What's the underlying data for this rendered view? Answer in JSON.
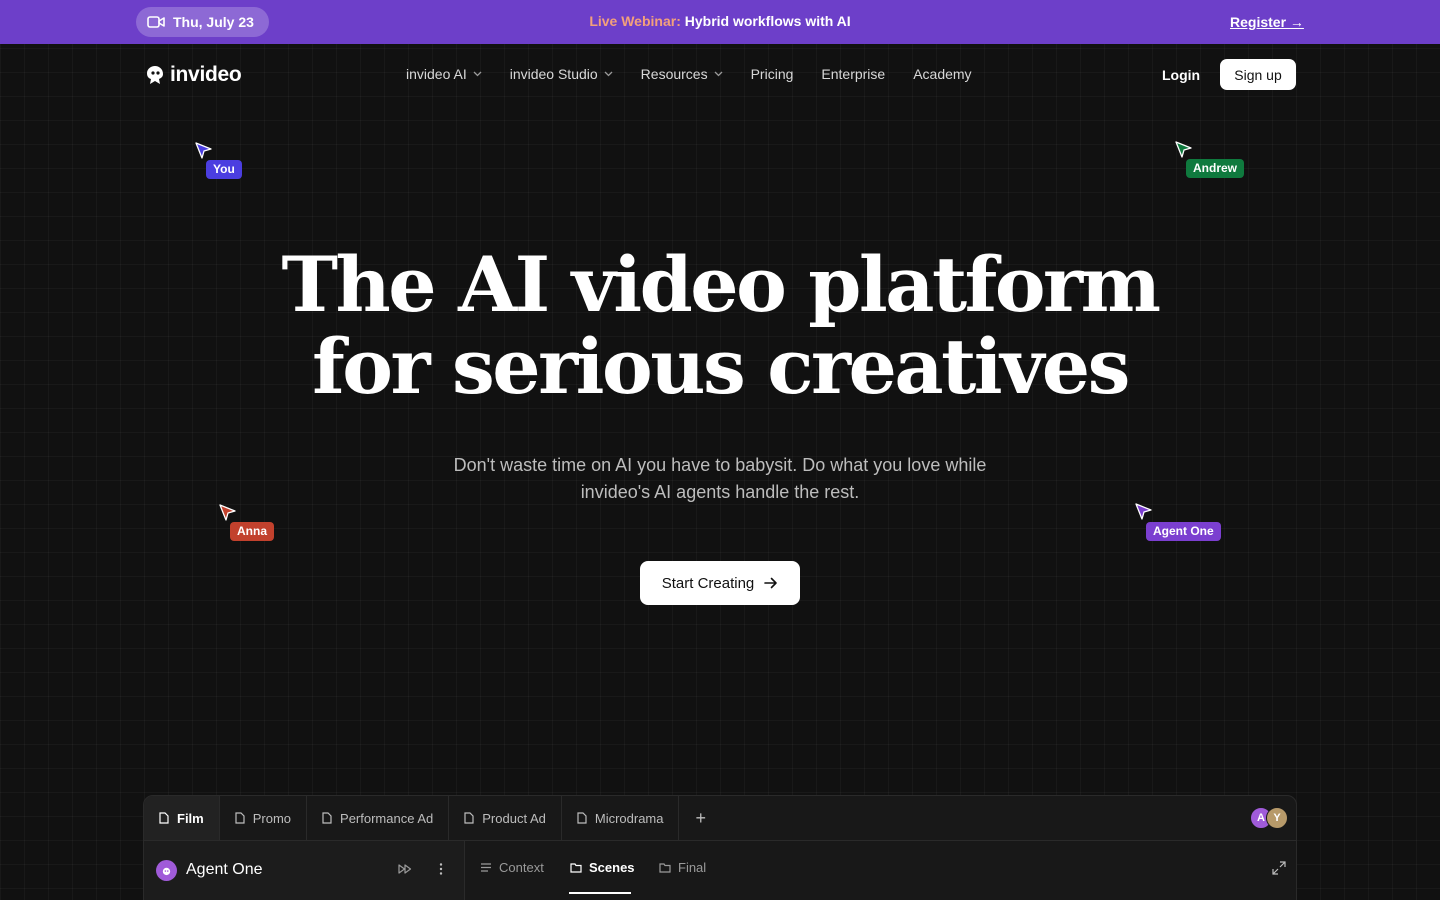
{
  "banner": {
    "date": "Thu, July 23",
    "webinar_highlight": "Live Webinar:",
    "webinar_text": "Hybrid workflows with AI",
    "register": "Register →"
  },
  "nav": {
    "logo": "invideo",
    "links": [
      "invideo AI",
      "invideo Studio",
      "Resources",
      "Pricing",
      "Enterprise",
      "Academy"
    ],
    "login": "Login",
    "signup": "Sign up"
  },
  "cursors": [
    {
      "label": "You",
      "color": "#4b3ee0"
    },
    {
      "label": "Andrew",
      "color": "#0f7a3e"
    },
    {
      "label": "Anna",
      "color": "#c2412d"
    },
    {
      "label": "Agent One",
      "color": "#7b3fd0"
    }
  ],
  "hero": {
    "title_line1": "The AI video platform",
    "title_line2": "for serious creatives",
    "subtitle_line1": "Don't waste time on AI you have to babysit. Do what you love while",
    "subtitle_line2": "invideo's AI agents handle the rest.",
    "cta": "Start Creating"
  },
  "panel": {
    "tabs": [
      "Film",
      "Promo",
      "Performance Ad",
      "Product Ad",
      "Microdrama"
    ],
    "avatars": [
      "A",
      "Y"
    ],
    "agent_name": "Agent One",
    "subtabs": [
      "Context",
      "Scenes",
      "Final"
    ]
  },
  "colors": {
    "banner_bg": "#6d3fc9",
    "page_bg": "#111111",
    "webinar_highlight": "#f3a07b"
  }
}
